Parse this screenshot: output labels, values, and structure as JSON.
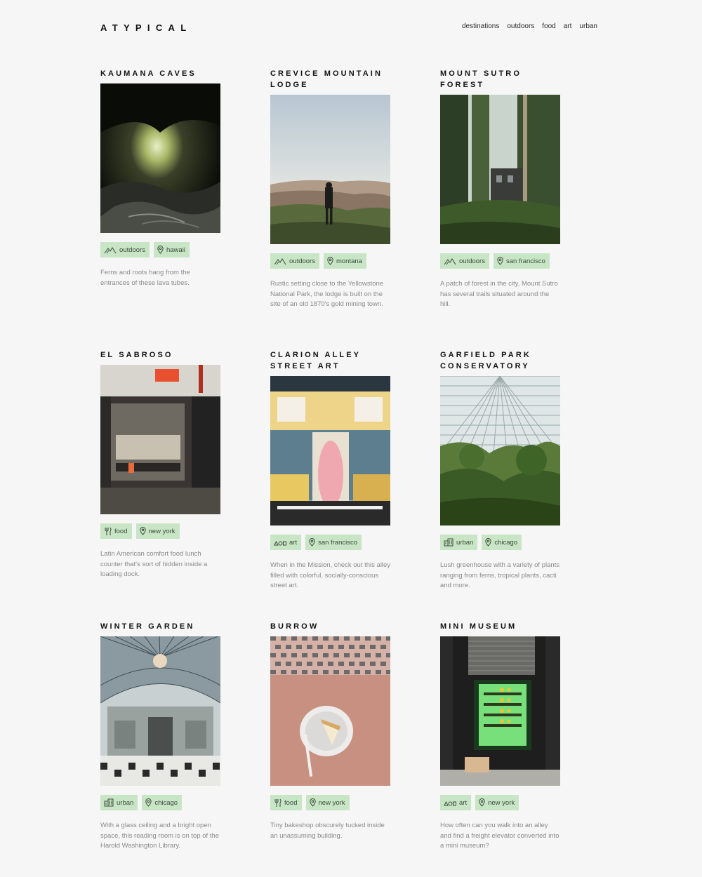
{
  "header": {
    "logo": "ATYPICAL",
    "nav": [
      "destinations",
      "outdoors",
      "food",
      "art",
      "urban"
    ]
  },
  "colors": {
    "background": "#f5f6f5",
    "tag_bg": "#c8e6c5",
    "text_muted": "#8a8a8a"
  },
  "places": [
    {
      "title": "KAUMANA CAVES",
      "category": "outdoors",
      "category_icon": "mountain-icon",
      "location": "hawaii",
      "description": "Ferns and roots hang from the entrances of these lava tubes.",
      "image": "cave"
    },
    {
      "title": "CREVICE MOUNTAIN LODGE",
      "category": "outdoors",
      "category_icon": "mountain-icon",
      "location": "montana",
      "description": "Rustic setting close to the Yellowstone National Park, the lodge is built on the site of an old 1870's gold mining town.",
      "image": "mountain-vista"
    },
    {
      "title": "MOUNT SUTRO FOREST",
      "category": "outdoors",
      "category_icon": "mountain-icon",
      "location": "san francisco",
      "description": "A patch of forest in the city, Mount Sutro has several trails situated around the hill.",
      "image": "forest"
    },
    {
      "title": "EL SABROSO",
      "category": "food",
      "category_icon": "utensils-icon",
      "location": "new york",
      "description": "Latin American comfort food lunch counter that's sort of hidden inside a loading dock.",
      "image": "restaurant"
    },
    {
      "title": "CLARION ALLEY STREET ART",
      "category": "art",
      "category_icon": "shapes-icon",
      "location": "san francisco",
      "description": "When in the Mission, check out this alley filled with colorful, socially-conscious street art.",
      "image": "mural"
    },
    {
      "title": "GARFIELD PARK CONSERVATORY",
      "category": "urban",
      "category_icon": "building-icon",
      "location": "chicago",
      "description": "Lush greenhouse with a variety of plants ranging from ferns, tropical plants, cacti and more.",
      "image": "greenhouse"
    },
    {
      "title": "WINTER GARDEN",
      "category": "urban",
      "category_icon": "building-icon",
      "location": "chicago",
      "description": "With a glass ceiling and a bright open space, this reading room is on top of the Harold Washington Library.",
      "image": "atrium"
    },
    {
      "title": "BURROW",
      "category": "food",
      "category_icon": "utensils-icon",
      "location": "new york",
      "description": "Tiny bakeshop obscurely tucked inside an unassuming building.",
      "image": "cake"
    },
    {
      "title": "MINI MUSEUM",
      "category": "art",
      "category_icon": "shapes-icon",
      "location": "new york",
      "description": "How often can you walk into an alley and find a freight elevator converted into a mini museum?",
      "image": "museum"
    }
  ]
}
